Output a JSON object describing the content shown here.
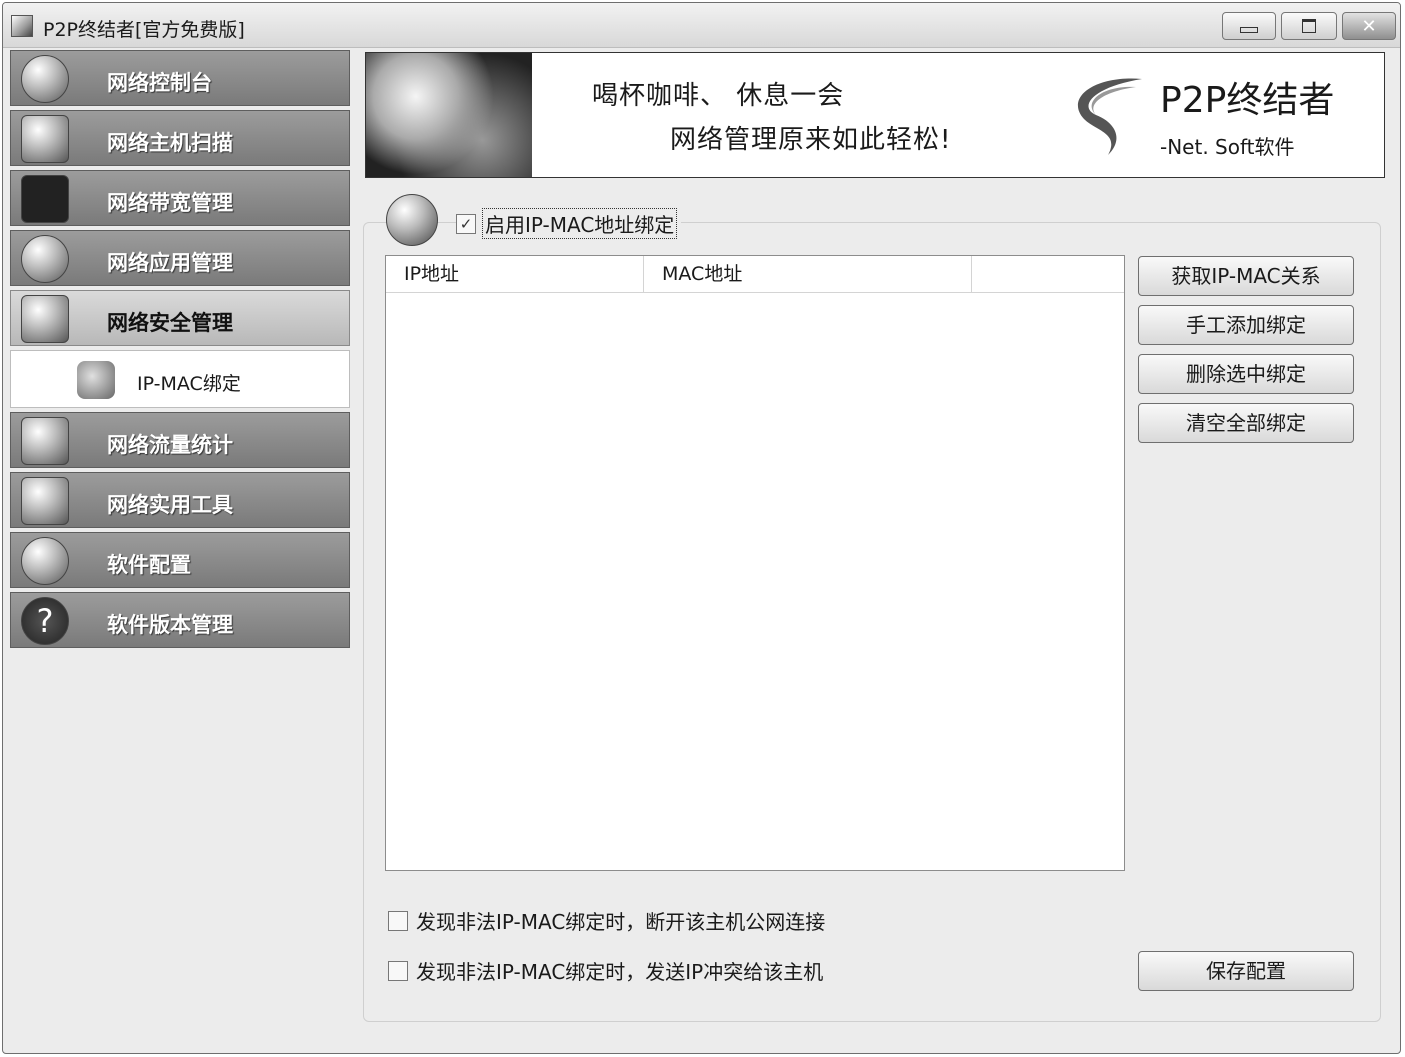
{
  "window": {
    "title": "P2P终结者[官方免费版]",
    "close_glyph": "✕"
  },
  "sidebar": {
    "items": [
      {
        "label": "网络控制台",
        "icon": "globe-icon"
      },
      {
        "label": "网络主机扫描",
        "icon": "computer-icon"
      },
      {
        "label": "网络带宽管理",
        "icon": "bandwidth-icon"
      },
      {
        "label": "网络应用管理",
        "icon": "application-icon"
      },
      {
        "label": "网络安全管理",
        "icon": "keys-icon",
        "active": true
      },
      {
        "label": "网络流量统计",
        "icon": "chart-icon"
      },
      {
        "label": "网络实用工具",
        "icon": "tools-icon"
      },
      {
        "label": "软件配置",
        "icon": "config-icon"
      },
      {
        "label": "软件版本管理",
        "icon": "help-icon"
      }
    ],
    "subitem": {
      "label": "IP-MAC绑定",
      "icon": "keys-icon"
    }
  },
  "banner": {
    "slogan1": "喝杯咖啡、 休息一会",
    "slogan2": "网络管理原来如此轻松!",
    "brand_name": "P2P终结者",
    "brand_sub": "-Net. Soft软件"
  },
  "main": {
    "enable_binding_label": "启用IP-MAC地址绑定",
    "enable_binding_checked": true,
    "check_glyph": "✓",
    "table": {
      "columns": [
        "IP地址",
        "MAC地址",
        ""
      ],
      "rows": []
    },
    "buttons": {
      "get_relation": "获取IP-MAC关系",
      "manual_add": "手工添加绑定",
      "delete_selected": "删除选中绑定",
      "clear_all": "清空全部绑定",
      "save_config": "保存配置"
    },
    "options": [
      {
        "label": "发现非法IP-MAC绑定时，断开该主机公网连接",
        "checked": false
      },
      {
        "label": "发现非法IP-MAC绑定时，发送IP冲突给该主机",
        "checked": false
      }
    ]
  }
}
